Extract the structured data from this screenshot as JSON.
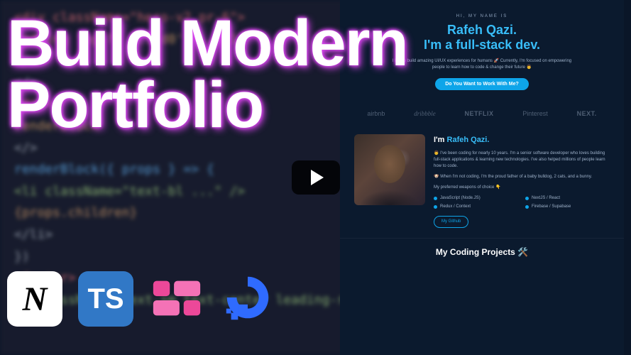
{
  "overlay": {
    "title_line1": "Build Modern",
    "title_line2": "Portfolio"
  },
  "tech_icons": {
    "next_label": "N",
    "ts_label": "TS"
  },
  "code_lines": [
    {
      "cls": "tag",
      "t": "<div className=\"hero-v2 pr-6\">"
    },
    {
      "cls": "attr",
      "t": "  padding   'bg-?'  '...d0'   '...d1'"
    },
    {
      "cls": "plain",
      "t": "</>"
    },
    {
      "cls": "plain",
      "t": "</>"
    },
    {
      "cls": "tag",
      "t": "<div>"
    },
    {
      "cls": "attr",
      "t": "  renderBlock"
    },
    {
      "cls": "plain",
      "t": "</>"
    },
    {
      "cls": "plain",
      "t": ""
    },
    {
      "cls": "var",
      "t": "renderBlock({ props } => {"
    },
    {
      "cls": "str",
      "t": "  <li className=\"text-bl ...\" />"
    },
    {
      "cls": "attr",
      "t": "    {props.children}"
    },
    {
      "cls": "plain",
      "t": "  </li>"
    },
    {
      "cls": "plain",
      "t": "})"
    },
    {
      "cls": "plain",
      "t": ""
    },
    {
      "cls": "tag",
      "t": "<footer>"
    },
    {
      "cls": "str",
      "t": "  <p className=\"text-sm text-center leading-relaxed\">"
    }
  ],
  "portfolio": {
    "eyebrow": "HI, MY NAME IS",
    "name": "Rafeh Qazi.",
    "role": "I'm a full-stack dev.",
    "desc": "I like to build amazing UI/UX experiences for humans 🚀 Currently, I'm focused on empowering people to learn how to code & change their future 👨",
    "cta": "Do You Want to Work With Me?",
    "brands": [
      "airbnb",
      "dribbble",
      "NETFLIX",
      "Pinterest",
      "NEXT."
    ],
    "about_title_prefix": "I'm ",
    "about_title_name": "Rafeh Qazi.",
    "about_p1": "👨 I've been coding for nearly 10 years. I'm a senior software developer who loves building full-stack applications & learning new technologies. I've also helped millions of people learn how to code.",
    "about_p2": "🐶 When I'm not coding, I'm the proud father of a baby bulldog, 2 cats, and a bunny.",
    "about_p3": "My preferred weapons of choice 👇",
    "skills": [
      "JavaScript (Node.JS)",
      "NextJS / React",
      "Redux / Context",
      "Firebase / Supabase"
    ],
    "github_btn": "My Github",
    "projects_heading": "My Coding Projects 🛠️"
  }
}
